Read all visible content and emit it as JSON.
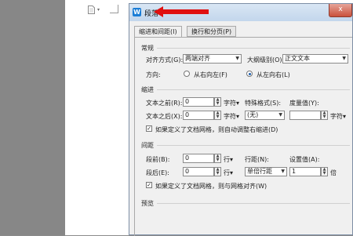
{
  "dialog": {
    "title": "段落",
    "close_label": "x",
    "tabs": [
      {
        "label": "缩进和间距(I)",
        "active": true
      },
      {
        "label": "换行和分页(P)",
        "active": false
      }
    ]
  },
  "general": {
    "section": "常规",
    "alignment_label": "对齐方式(G):",
    "alignment_value": "两端对齐",
    "outline_label": "大纲级别(O):",
    "outline_value": "正文文本",
    "direction_label": "方向:",
    "direction_rtl": "从右向左(F)",
    "direction_ltr": "从左向右(L)",
    "direction_selected": "ltr"
  },
  "indent": {
    "section": "缩进",
    "before_label": "文本之前(R):",
    "before_value": "0",
    "before_unit": "字符▾",
    "after_label": "文本之后(X):",
    "after_value": "0",
    "after_unit": "字符▾",
    "special_label": "特殊格式(S):",
    "special_value": "(无)",
    "measure_label": "度量值(Y):",
    "measure_value": "",
    "measure_unit": "字符▾",
    "grid_check_label": "如果定义了文档网格，则自动调整右缩进(D)",
    "grid_checked": true
  },
  "spacing": {
    "section": "间距",
    "before_label": "段前(B):",
    "before_value": "0",
    "before_unit": "行▾",
    "after_label": "段后(E):",
    "after_value": "0",
    "after_unit": "行▾",
    "line_label": "行距(N):",
    "line_value": "单倍行距",
    "setting_label": "设置值(A):",
    "setting_value": "1",
    "setting_unit": "倍",
    "grid_check_label": "如果定义了文档网格，则与网格对齐(W)",
    "grid_checked": true
  },
  "preview": {
    "section": "预览"
  },
  "icons": {
    "app": "wps-writer-icon",
    "page": "page-icon",
    "annotation": "red-arrow-icon"
  },
  "colors": {
    "accent": "#1b7dd6",
    "arrow": "#e01010",
    "close": "#c9513c"
  }
}
